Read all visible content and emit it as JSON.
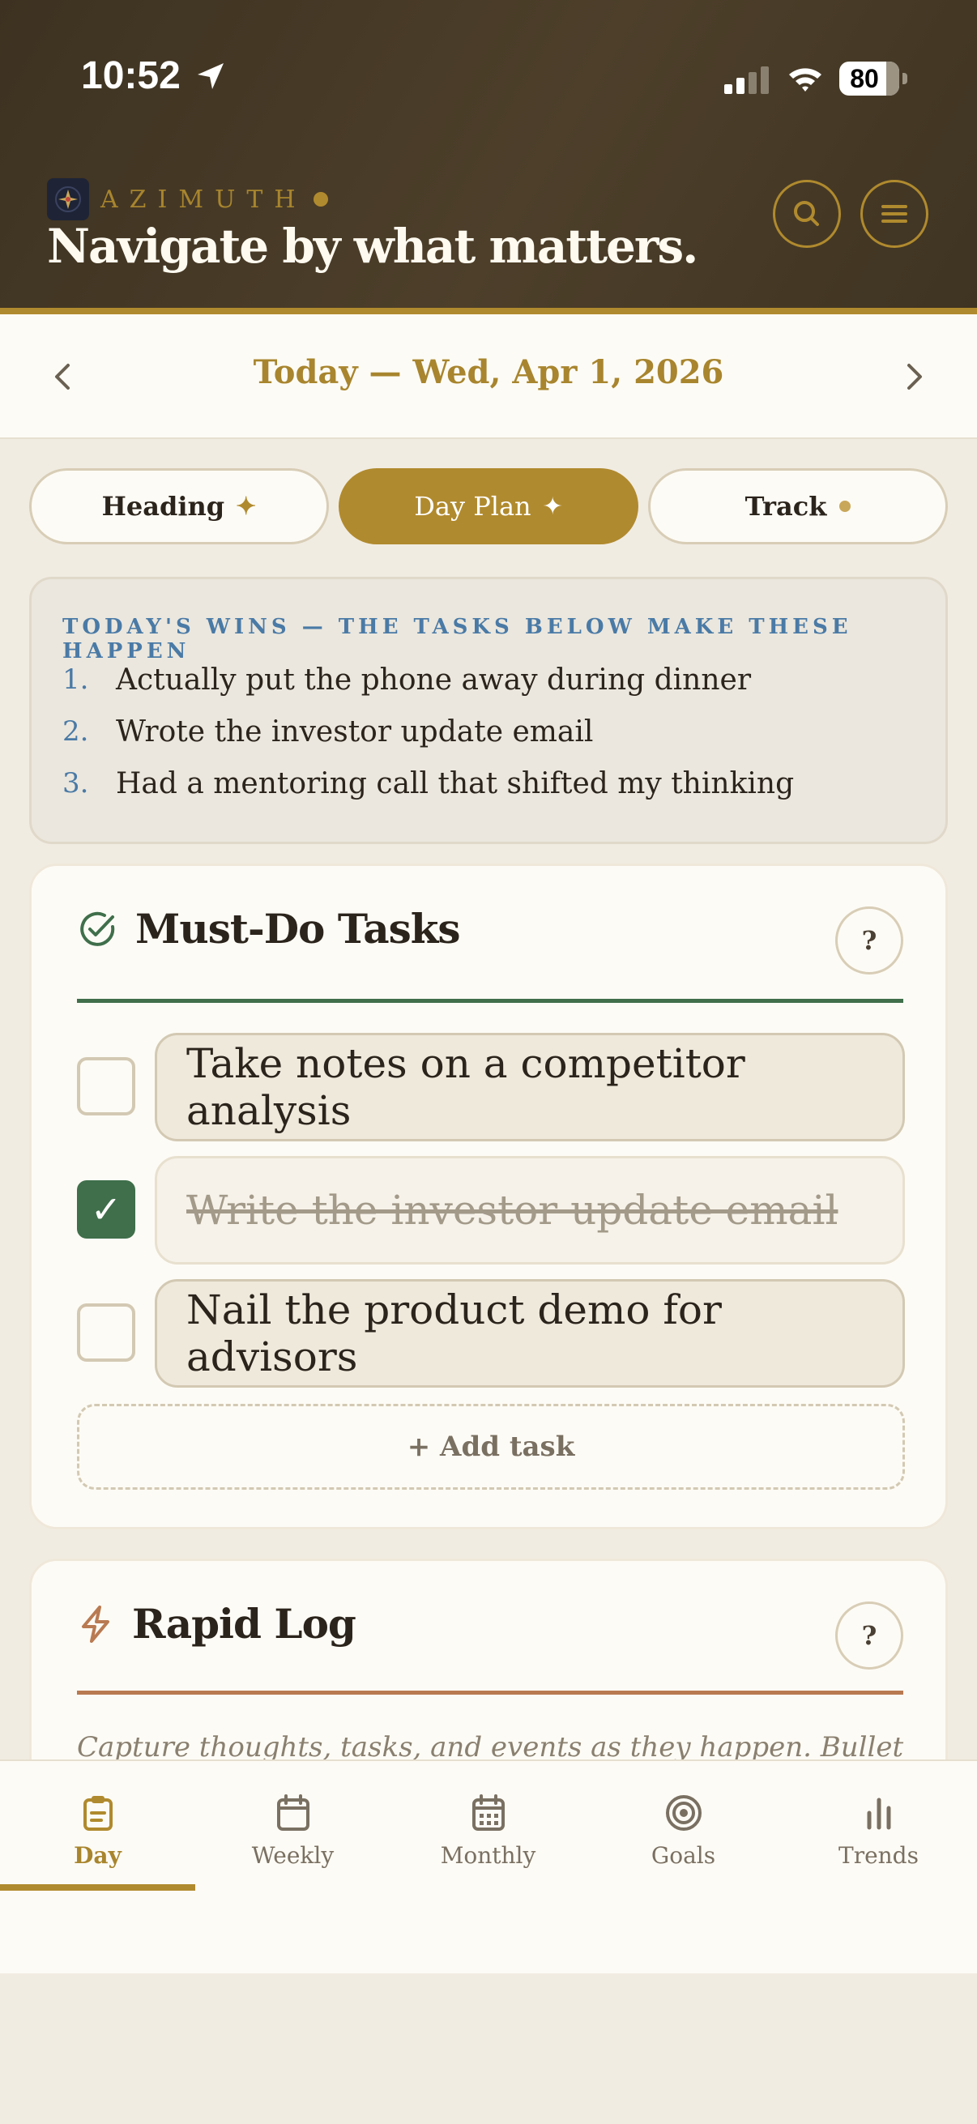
{
  "status_bar": {
    "time": "10:52",
    "battery": "80"
  },
  "header": {
    "brand": "AZIMUTH",
    "tagline": "Navigate by what matters."
  },
  "date_nav": {
    "label": "Today — Wed, Apr 1, 2026"
  },
  "tabs": [
    {
      "label": "Heading",
      "marker": "✦",
      "active": false
    },
    {
      "label": "Day Plan",
      "marker": "✦",
      "active": true
    },
    {
      "label": "Track",
      "marker": "dot",
      "active": false
    }
  ],
  "wins": {
    "title": "TODAY'S WINS — THE TASKS BELOW MAKE THESE HAPPEN",
    "items": [
      {
        "num": "1.",
        "text": "Actually put the phone away during dinner"
      },
      {
        "num": "2.",
        "text": "Wrote the investor update email"
      },
      {
        "num": "3.",
        "text": "Had a mentoring call that shifted my thinking"
      }
    ]
  },
  "must_do": {
    "title": "Must-Do Tasks",
    "help": "?",
    "tasks": [
      {
        "text": "Take notes on a competitor analysis",
        "done": false
      },
      {
        "text": "Write the investor update email",
        "done": true
      },
      {
        "text": "Nail the product demo for advisors",
        "done": false
      }
    ],
    "add_label": "+ Add task",
    "check_glyph": "✓"
  },
  "rapid_log": {
    "title": "Rapid Log",
    "help": "?",
    "description": "Capture thoughts, tasks, and events as they happen. Bullet"
  },
  "bottom_nav": [
    {
      "label": "Day",
      "icon": "clipboard-icon",
      "active": true
    },
    {
      "label": "Weekly",
      "icon": "calendar-icon",
      "active": false
    },
    {
      "label": "Monthly",
      "icon": "calendar-grid-icon",
      "active": false
    },
    {
      "label": "Goals",
      "icon": "target-icon",
      "active": false
    },
    {
      "label": "Trends",
      "icon": "bar-chart-icon",
      "active": false
    }
  ],
  "colors": {
    "accent_gold": "#b08a2e",
    "header_brown": "#4d3f2a",
    "must_do_green": "#3f6f4b",
    "rapid_log_copper": "#b97a52",
    "wins_blue": "#4a7aa6"
  }
}
